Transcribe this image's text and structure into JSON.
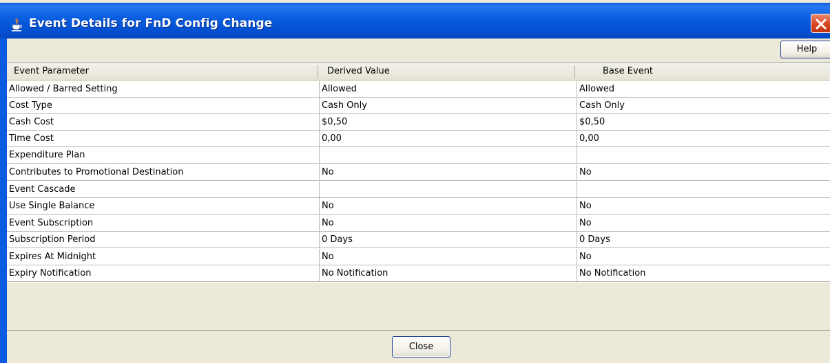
{
  "window": {
    "title": "Event Details for FnD Config Change"
  },
  "toolbar": {
    "help_label": "Help"
  },
  "table": {
    "columns": [
      "Event Parameter",
      "Derived Value",
      "Base Event"
    ],
    "rows": [
      [
        "Allowed / Barred Setting",
        "Allowed",
        "Allowed"
      ],
      [
        "Cost Type",
        "Cash Only",
        "Cash Only"
      ],
      [
        "Cash Cost",
        "$0,50",
        "$0,50"
      ],
      [
        "Time Cost",
        "0,00",
        "0,00"
      ],
      [
        "Expenditure Plan",
        "",
        ""
      ],
      [
        "Contributes to Promotional Destination",
        "No",
        "No"
      ],
      [
        "Event Cascade",
        "",
        ""
      ],
      [
        "Use Single Balance",
        "No",
        "No"
      ],
      [
        "Event Subscription",
        "No",
        "No"
      ],
      [
        "Subscription Period",
        "0 Days",
        "0 Days"
      ],
      [
        "Expires At Midnight",
        "No",
        "No"
      ],
      [
        "Expiry Notification",
        "No Notification",
        "No Notification"
      ]
    ]
  },
  "footer": {
    "close_label": "Close"
  },
  "icons": {
    "title_icon": "java-cup-icon",
    "window_close": "close-icon"
  },
  "colors": {
    "titlebar": "#0a5fe0",
    "window_bg": "#ece9d8",
    "close_button": "#d9441e"
  }
}
